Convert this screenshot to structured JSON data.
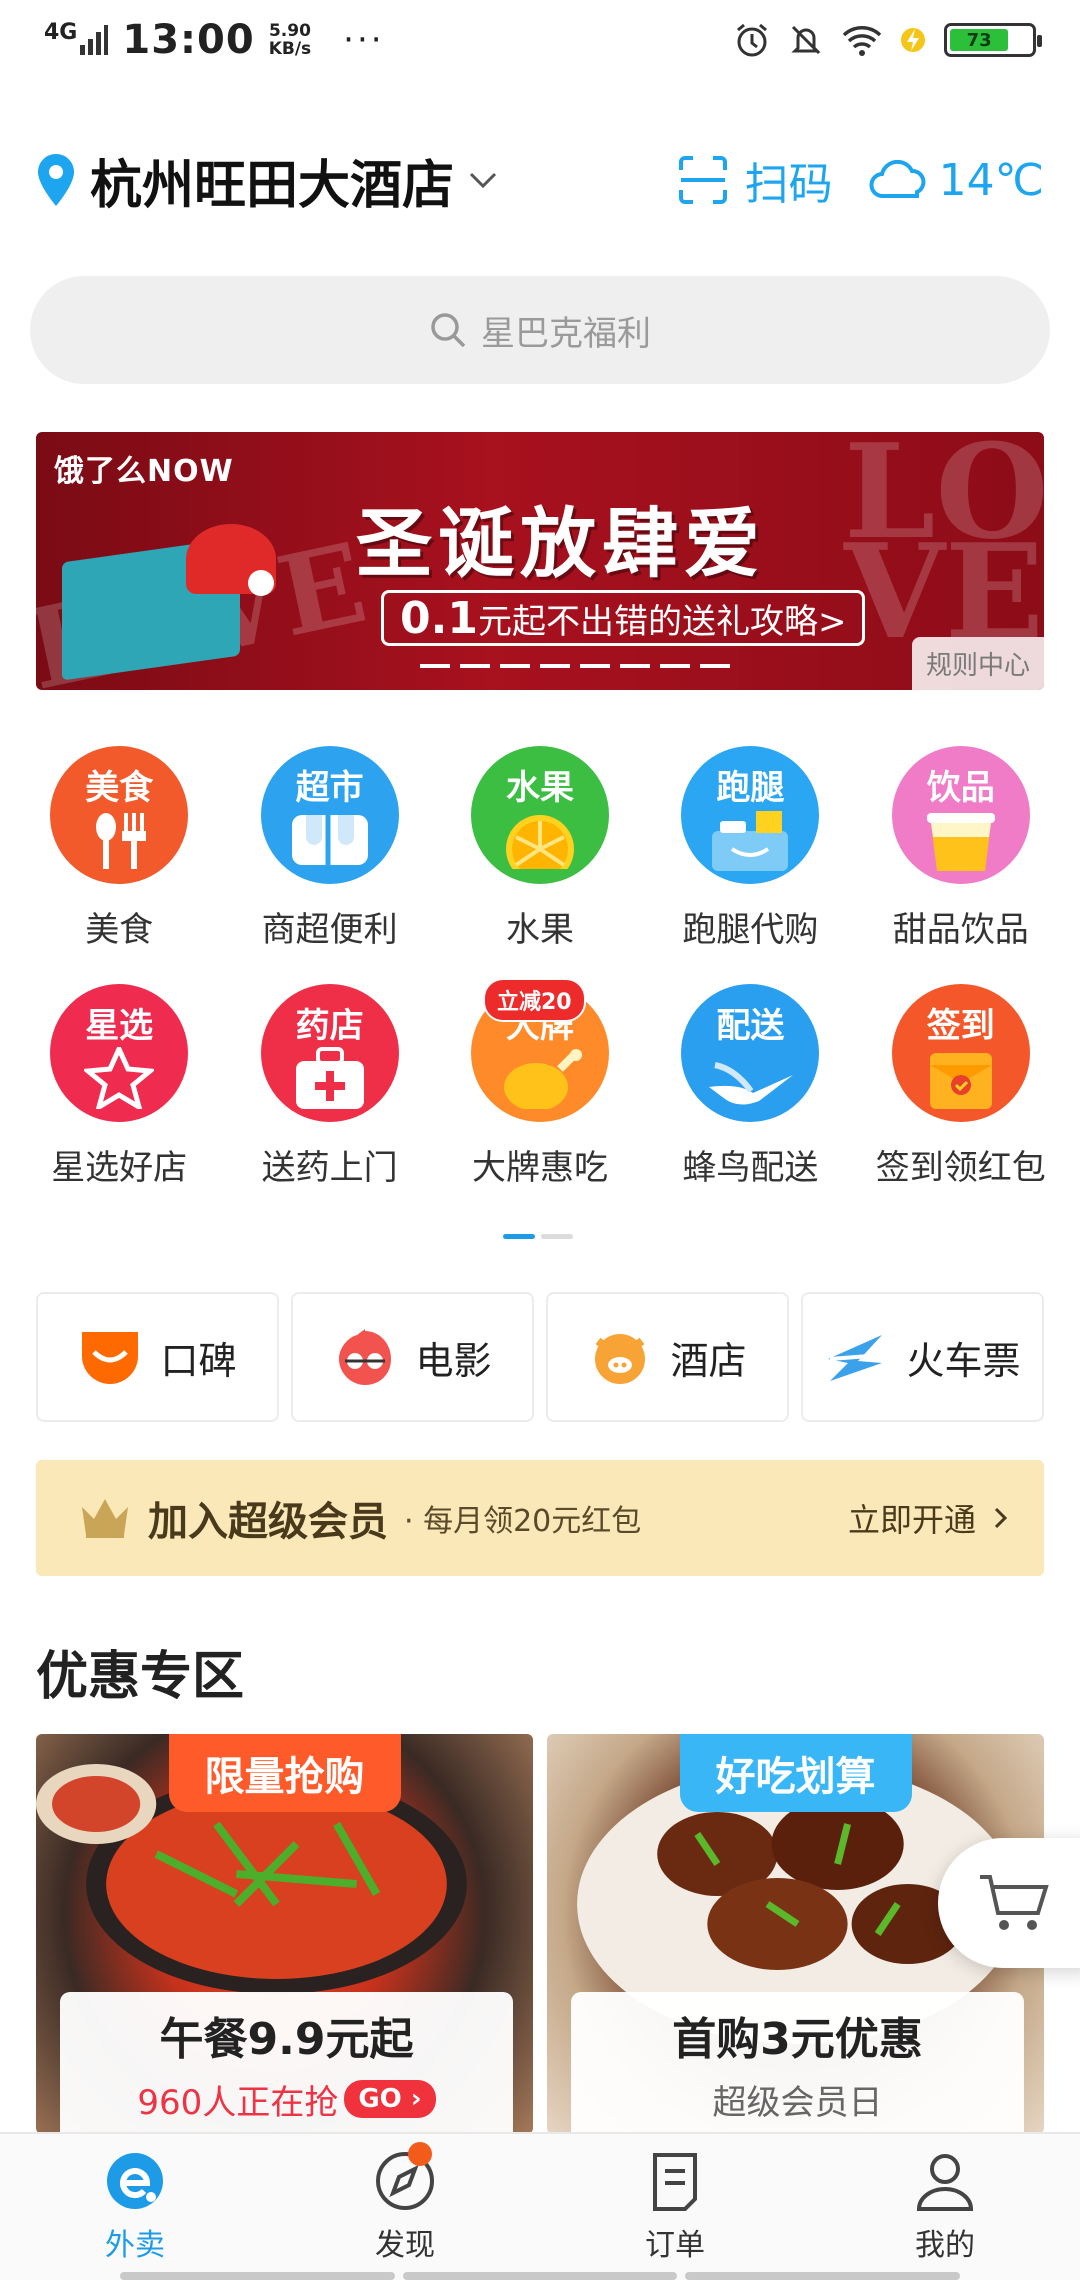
{
  "status_bar": {
    "network": "4G",
    "time": "13:00",
    "speed_value": "5.90",
    "speed_unit": "KB/s",
    "more": "···",
    "battery": "73"
  },
  "header": {
    "location": "杭州旺田大酒店",
    "scan_label": "扫码",
    "temperature": "14℃"
  },
  "search": {
    "placeholder": "星巴克福利"
  },
  "banner": {
    "brand": "饿了么NOW",
    "headline": "圣诞放肆爱",
    "sub_price": "0.1",
    "sub_text": "元起不出错的送礼攻略>",
    "rule_link": "规则中心",
    "decor_text": "LOVE"
  },
  "categories": [
    {
      "icon_text": "美食",
      "label": "美食",
      "icon": "food-icon",
      "color": "#f25a2c"
    },
    {
      "icon_text": "超市",
      "label": "商超便利",
      "icon": "supermarket-icon",
      "color": "#2da3f0"
    },
    {
      "icon_text": "水果",
      "label": "水果",
      "icon": "fruit-icon",
      "color": "#3cbe43"
    },
    {
      "icon_text": "跑腿",
      "label": "跑腿代购",
      "icon": "errand-icon",
      "color": "#2aa6f2"
    },
    {
      "icon_text": "饮品",
      "label": "甜品饮品",
      "icon": "drink-icon",
      "color": "#f07cc7"
    },
    {
      "icon_text": "星选",
      "label": "星选好店",
      "icon": "star-select-icon",
      "color": "#ef2c4f"
    },
    {
      "icon_text": "药店",
      "label": "送药上门",
      "icon": "pharmacy-icon",
      "color": "#ee2f47"
    },
    {
      "icon_text": "大牌",
      "label": "大牌惠吃",
      "icon": "brand-food-icon",
      "color": "#ff8a2a",
      "badge": "立减20"
    },
    {
      "icon_text": "配送",
      "label": "蜂鸟配送",
      "icon": "delivery-bird-icon",
      "color": "#2a9ff0"
    },
    {
      "icon_text": "签到",
      "label": "签到领红包",
      "icon": "checkin-redpacket-icon",
      "color": "#f4572a"
    }
  ],
  "quick_links": [
    {
      "label": "口碑",
      "icon": "koubei-icon",
      "color": "#ff6a00"
    },
    {
      "label": "电影",
      "icon": "movie-icon",
      "color": "#f2534e"
    },
    {
      "label": "酒店",
      "icon": "hotel-icon",
      "color": "#f7a335"
    },
    {
      "label": "火车票",
      "icon": "train-ticket-icon",
      "color": "#3ba1ea"
    }
  ],
  "vip": {
    "title": "加入超级会员",
    "subtitle": "· 每月领20元红包",
    "cta": "立即开通"
  },
  "section": {
    "title": "优惠专区"
  },
  "promos": [
    {
      "tag": "限量抢购",
      "tag_color": "#ff5b2a",
      "title": "午餐9.9元起",
      "subtitle": "960人正在抢",
      "go": "GO"
    },
    {
      "tag": "好吃划算",
      "tag_color": "#38b6f5",
      "title": "首购3元优惠",
      "subtitle": "超级会员日"
    }
  ],
  "tabs": [
    {
      "label": "外卖",
      "icon": "takeout-icon",
      "active": true
    },
    {
      "label": "发现",
      "icon": "compass-icon"
    },
    {
      "label": "订单",
      "icon": "order-icon"
    },
    {
      "label": "我的",
      "icon": "profile-icon"
    }
  ],
  "colors": {
    "accent": "#1e9be6",
    "vip_bg": "#fbe8b8"
  }
}
